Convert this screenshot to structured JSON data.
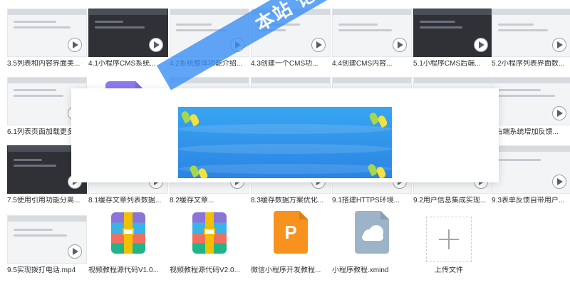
{
  "files": [
    {
      "name": "3.5列表和内容界面美...",
      "type": "video",
      "theme": "light"
    },
    {
      "name": "4.1小程序CMS系统...",
      "type": "video",
      "theme": "dark"
    },
    {
      "name": "4.2系统整体功能介绍...",
      "type": "video",
      "theme": "light"
    },
    {
      "name": "4.3创建一个CMS功...",
      "type": "video",
      "theme": "light"
    },
    {
      "name": "4.4创建CMS内容...",
      "type": "video",
      "theme": "light"
    },
    {
      "name": "5.1小程序CMS后端...",
      "type": "video",
      "theme": "dark"
    },
    {
      "name": "5.2小程序列表界面数...",
      "type": "video",
      "theme": "light"
    },
    {
      "name": "6.1列表页面加载更多",
      "type": "video",
      "theme": "light"
    },
    {
      "name": "",
      "type": "purple"
    },
    {
      "name": "",
      "type": "video",
      "theme": "light"
    },
    {
      "name": "",
      "type": "video",
      "theme": "light"
    },
    {
      "name": "",
      "type": "video",
      "theme": "light"
    },
    {
      "name": "",
      "type": "video",
      "theme": "light"
    },
    {
      "name": "8后端系统增加反馈...",
      "type": "video",
      "theme": "light"
    },
    {
      "name": "7.5使用引用功能分离...",
      "type": "video",
      "theme": "dark"
    },
    {
      "name": "8.1缓存文章列表数据...",
      "type": "video",
      "theme": "light"
    },
    {
      "name": "8.2缓存文章...",
      "type": "video",
      "theme": "light"
    },
    {
      "name": "8.3缓存数据方案优化...",
      "type": "video",
      "theme": "light"
    },
    {
      "name": "9.1搭建HTTPS环境...",
      "type": "video",
      "theme": "light"
    },
    {
      "name": "9.2用户信息集成实现...",
      "type": "video",
      "theme": "light"
    },
    {
      "name": "9.3表单反馈自带用户...",
      "type": "video",
      "theme": "light"
    },
    {
      "name": "9.5实现拨打电话.mp4",
      "type": "video",
      "theme": "light"
    },
    {
      "name": "视频教程源代码V1.0...",
      "type": "rar"
    },
    {
      "name": "视频教程源代码V2.0...",
      "type": "rar"
    },
    {
      "name": "微信小程序开发教程...",
      "type": "ppt",
      "letter": "P"
    },
    {
      "name": "小程序教程.xmind",
      "type": "xmind"
    },
    {
      "name": "上传文件",
      "type": "upload"
    }
  ],
  "watermark": {
    "text": "本站 论坛"
  }
}
